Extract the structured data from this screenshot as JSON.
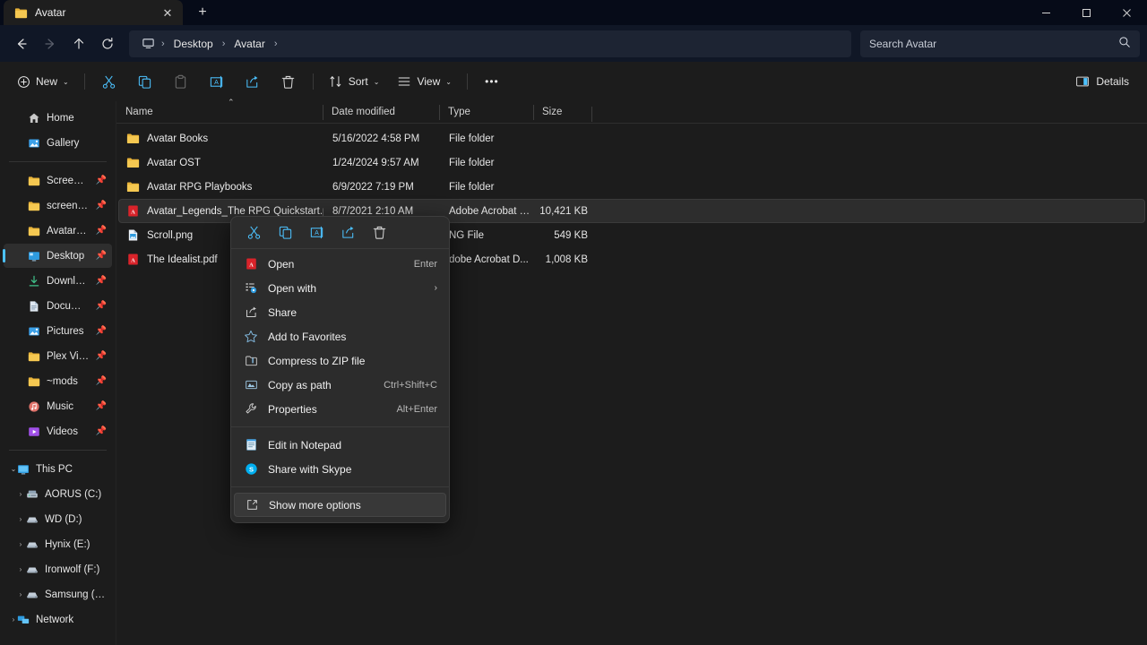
{
  "window": {
    "tab_title": "Avatar",
    "tab_close_glyph": "✕",
    "new_tab_glyph": "+",
    "minimize_glyph": "—",
    "maximize_glyph": "▢",
    "close_glyph": "✕"
  },
  "address": {
    "back_glyph": "←",
    "forward_glyph": "→",
    "up_glyph": "↑",
    "refresh_glyph": "⟳",
    "crumbs": [
      "Desktop",
      "Avatar"
    ],
    "separator": "›"
  },
  "search": {
    "placeholder": "Search Avatar",
    "value": ""
  },
  "toolbar": {
    "new_label": "New",
    "sort_label": "Sort",
    "view_label": "View",
    "more_glyph": "•••",
    "details_label": "Details",
    "chevron": "⌄"
  },
  "sidebar": {
    "quick": [
      {
        "label": "Home",
        "icon": "home-icon",
        "pinned": false
      },
      {
        "label": "Gallery",
        "icon": "gallery-icon",
        "pinned": false
      }
    ],
    "pinned": [
      {
        "label": "Screenshots",
        "icon": "folder-icon",
        "pinned": true
      },
      {
        "label": "screenshots",
        "icon": "folder-icon",
        "pinned": true
      },
      {
        "label": "Avatar OST",
        "icon": "folder-icon",
        "pinned": true
      },
      {
        "label": "Desktop",
        "icon": "desktop-icon",
        "pinned": true,
        "selected": true
      },
      {
        "label": "Downloads",
        "icon": "downloads-icon",
        "pinned": true
      },
      {
        "label": "Documents",
        "icon": "documents-icon",
        "pinned": true
      },
      {
        "label": "Pictures",
        "icon": "pictures-icon",
        "pinned": true
      },
      {
        "label": "Plex Videos",
        "icon": "folder-icon",
        "pinned": true
      },
      {
        "label": "~mods",
        "icon": "folder-icon",
        "pinned": true
      },
      {
        "label": "Music",
        "icon": "music-icon",
        "pinned": true
      },
      {
        "label": "Videos",
        "icon": "videos-icon",
        "pinned": true
      }
    ],
    "thispc": {
      "label": "This PC",
      "icon": "pc-icon",
      "expanded": true,
      "expander": "⌄"
    },
    "drives": [
      {
        "label": "AORUS (C:)",
        "icon": "drive-system-icon",
        "expander": "›"
      },
      {
        "label": "WD (D:)",
        "icon": "drive-icon",
        "expander": "›"
      },
      {
        "label": "Hynix (E:)",
        "icon": "drive-icon",
        "expander": "›"
      },
      {
        "label": "Ironwolf (F:)",
        "icon": "drive-icon",
        "expander": "›"
      },
      {
        "label": "Samsung (S:)",
        "icon": "drive-icon",
        "expander": "›"
      }
    ],
    "network": {
      "label": "Network",
      "icon": "network-icon",
      "expander": "›"
    }
  },
  "filelist": {
    "columns": [
      "Name",
      "Date modified",
      "Type",
      "Size"
    ],
    "sort_caret": "⌃",
    "rows": [
      {
        "name": "Avatar Books",
        "date": "5/16/2022 4:58 PM",
        "type": "File folder",
        "size": "",
        "icon": "folder-icon"
      },
      {
        "name": "Avatar OST",
        "date": "1/24/2024 9:57 AM",
        "type": "File folder",
        "size": "",
        "icon": "folder-icon"
      },
      {
        "name": "Avatar RPG Playbooks",
        "date": "6/9/2022 7:19 PM",
        "type": "File folder",
        "size": "",
        "icon": "folder-icon"
      },
      {
        "name": "Avatar_Legends_The RPG Quickstart.pdf",
        "date": "8/7/2021 2:10 AM",
        "type": "Adobe Acrobat D...",
        "size": "10,421 KB",
        "icon": "pdf-icon",
        "selected": true
      },
      {
        "name": "Scroll.png",
        "date": "",
        "type": "NG File",
        "size": "549 KB",
        "icon": "png-icon"
      },
      {
        "name": "The Idealist.pdf",
        "date": "",
        "type": "dobe Acrobat D...",
        "size": "1,008 KB",
        "icon": "pdf-icon"
      }
    ]
  },
  "context_menu": {
    "toolbar_icons": [
      "cut-icon",
      "copy-icon",
      "rename-icon",
      "share-icon",
      "delete-icon"
    ],
    "items": [
      {
        "label": "Open",
        "accel": "Enter",
        "icon": "pdf-icon"
      },
      {
        "label": "Open with",
        "accel": "",
        "submenu": "›",
        "icon": "open-with-icon"
      },
      {
        "label": "Share",
        "accel": "",
        "icon": "share-icon"
      },
      {
        "label": "Add to Favorites",
        "accel": "",
        "icon": "star-icon"
      },
      {
        "label": "Compress to ZIP file",
        "accel": "",
        "icon": "zip-icon"
      },
      {
        "label": "Copy as path",
        "accel": "Ctrl+Shift+C",
        "icon": "copy-path-icon"
      },
      {
        "label": "Properties",
        "accel": "Alt+Enter",
        "icon": "wrench-icon"
      }
    ],
    "items2": [
      {
        "label": "Edit in Notepad",
        "accel": "",
        "icon": "notepad-icon"
      },
      {
        "label": "Share with Skype",
        "accel": "",
        "icon": "skype-icon"
      }
    ],
    "items3": [
      {
        "label": "Show more options",
        "accel": "",
        "icon": "more-options-icon",
        "highlight": true
      }
    ]
  },
  "colors": {
    "titlebar": "#060b18",
    "addressbar": "#101726",
    "content": "#1c1c1c",
    "accent": "#4cc2ff",
    "folder": "#e8b339",
    "pdf": "#d9232a"
  }
}
